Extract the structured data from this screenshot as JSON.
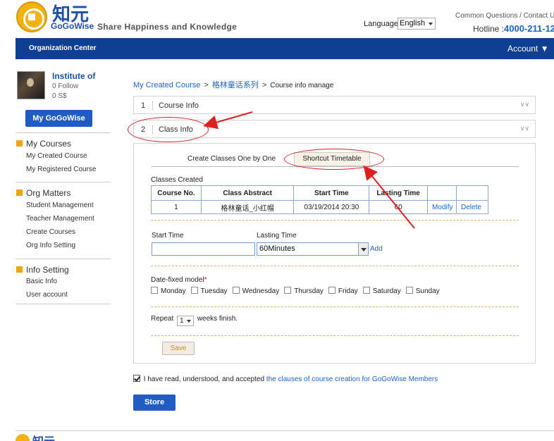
{
  "header": {
    "logo_cn": "知元",
    "logo_en": "GoGoWise",
    "tagline": "Share Happiness and Knowledge",
    "language_label": "Language",
    "language_value": "English",
    "top_links": "Common Questions / Contact U",
    "hotline_label": "Hotline :",
    "hotline_number": "4000-211-12"
  },
  "nav": {
    "org_center": "Organization Center",
    "account": "Account ▼"
  },
  "profile": {
    "name": "Institute of",
    "follow": "0 Follow",
    "money": "0 S$",
    "my_button": "My GoGoWise"
  },
  "sidebar": {
    "my_courses": "My Courses",
    "my_created": "My Created Course",
    "my_registered": "My Registered Course",
    "org_matters": "Org Matters",
    "student_mgmt": "Student Management",
    "teacher_mgmt": "Teacher Management",
    "create_courses": "Create Courses",
    "org_info": "Org Info Setting",
    "info_setting": "Info Setting",
    "basic_info": "Basic Info",
    "user_account": "User account"
  },
  "breadcrumb": {
    "item1": "My Created Course",
    "sep": ">",
    "item2": "格林童话系列",
    "item3": "Course info manage"
  },
  "sections": [
    {
      "index": "1",
      "label": "Course Info"
    },
    {
      "index": "2",
      "label": "Class Info"
    }
  ],
  "tabs": {
    "one_by_one": "Create Classes One by One",
    "shortcut": "Shortcut Timetable"
  },
  "classes": {
    "label": "Classes Created",
    "headers": [
      "Course No.",
      "Class Abstract",
      "Start Time",
      "Lasting Time",
      "",
      ""
    ],
    "row": {
      "no": "1",
      "abstract": "格林童话_小红帽",
      "start": "03/19/2014 20:30",
      "lasting": "60",
      "modify": "Modify",
      "delete": "Delete"
    }
  },
  "form": {
    "start_label": "Start Time",
    "lasting_label": "Lasting Time",
    "lasting_value": "60Minutes",
    "add": "Add",
    "date_fixed_label": "Date-fixed model",
    "required_mark": "*",
    "days": [
      "Monday",
      "Tuesday",
      "Wednesday",
      "Thursday",
      "Friday",
      "Saturday",
      "Sunday"
    ],
    "repeat_label": "Repeat",
    "repeat_value": "1",
    "repeat_suffix": "weeks finish.",
    "save": "Save"
  },
  "agreement": {
    "text": "I have read, understood, and accepted",
    "link": "the clauses of course creation for GoGoWise Members"
  },
  "store": "Store",
  "footer": {
    "logo_cn": "知元"
  },
  "colors": {
    "nav": "#0e3f91",
    "button": "#1f5cc4",
    "link": "#1a64c8",
    "annotation": "#e02020"
  }
}
